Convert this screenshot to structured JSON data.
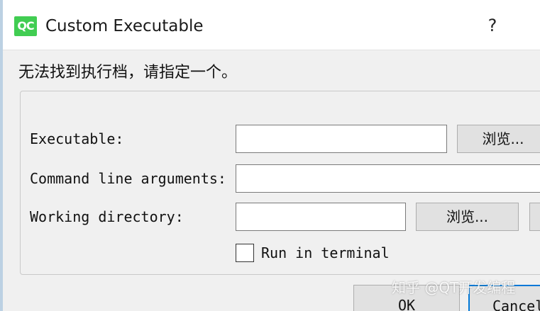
{
  "window": {
    "icon_text": "QC",
    "title": "Custom Executable",
    "help_label": "?"
  },
  "message": "无法找到执行档，请指定一个。",
  "form": {
    "executable": {
      "label": "Executable:",
      "value": "",
      "browse_label": "浏览..."
    },
    "arguments": {
      "label": "Command line arguments:",
      "value": ""
    },
    "working_directory": {
      "label": "Working directory:",
      "value": "",
      "browse_label": "浏览..."
    },
    "run_in_terminal": {
      "label": "Run in terminal",
      "checked": false
    }
  },
  "buttons": {
    "ok_label": "OK",
    "cancel_label": "Cancel"
  },
  "watermark": "知乎 @QT开发编程",
  "colors": {
    "qt_green": "#41cd52",
    "focus_blue": "#0078d7",
    "dialog_bg": "#f0f0f0"
  }
}
